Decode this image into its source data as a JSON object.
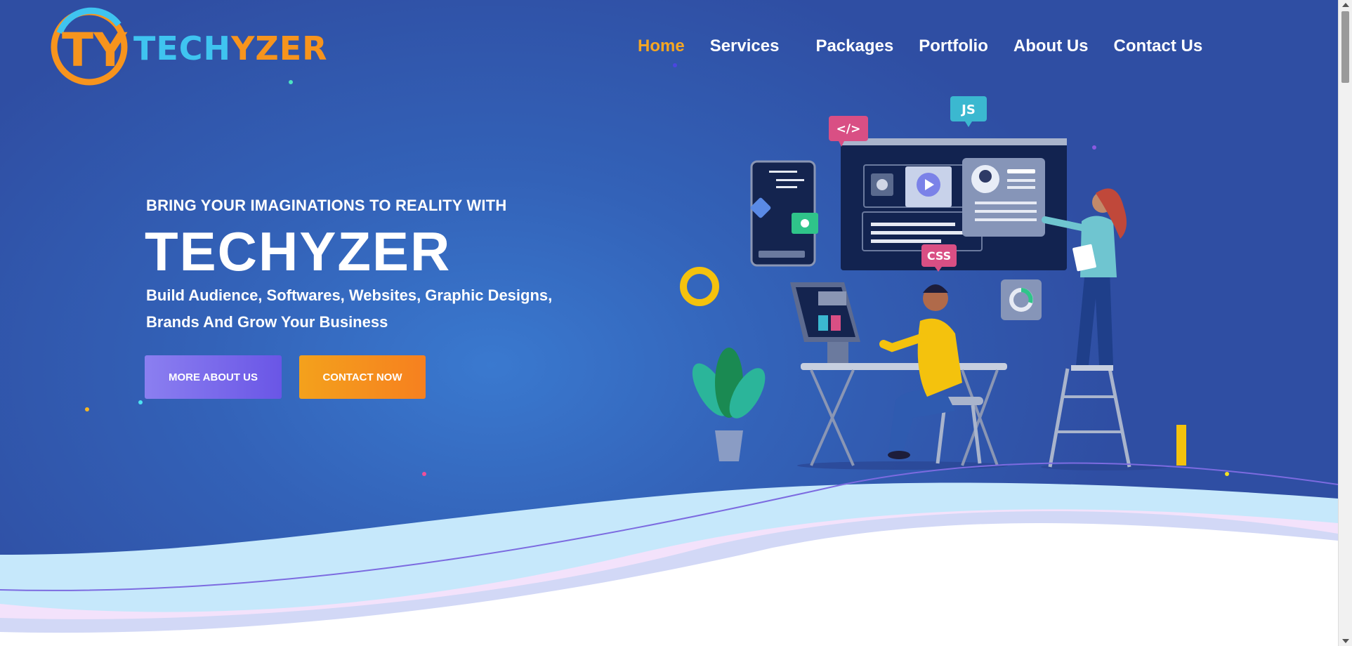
{
  "brand": {
    "logo_initials": "TY",
    "name_part1": "TECH",
    "name_part2": "YZER"
  },
  "nav": {
    "items": [
      "Home",
      "Services",
      "Packages",
      "Portfolio",
      "About Us",
      "Contact Us"
    ],
    "active": "Home"
  },
  "hero": {
    "tagline": "BRING YOUR IMAGINATIONS TO REALITY WITH",
    "headline": "TECHYZER",
    "subtext_line1": "Build Audience, Softwares, Websites, Graphic Designs,",
    "subtext_line2": "Brands And Grow Your Business",
    "btn_about": "MORE ABOUT US",
    "btn_contact": "CONTACT NOW"
  },
  "illustration": {
    "tag_code": "</>",
    "tag_js": "JS",
    "tag_css": "CSS"
  },
  "colors": {
    "accent_orange": "#f5a623",
    "logo_blue": "#3fc4f0",
    "hero_bg": "#3362b8",
    "button_purple": "#6a56e6"
  }
}
